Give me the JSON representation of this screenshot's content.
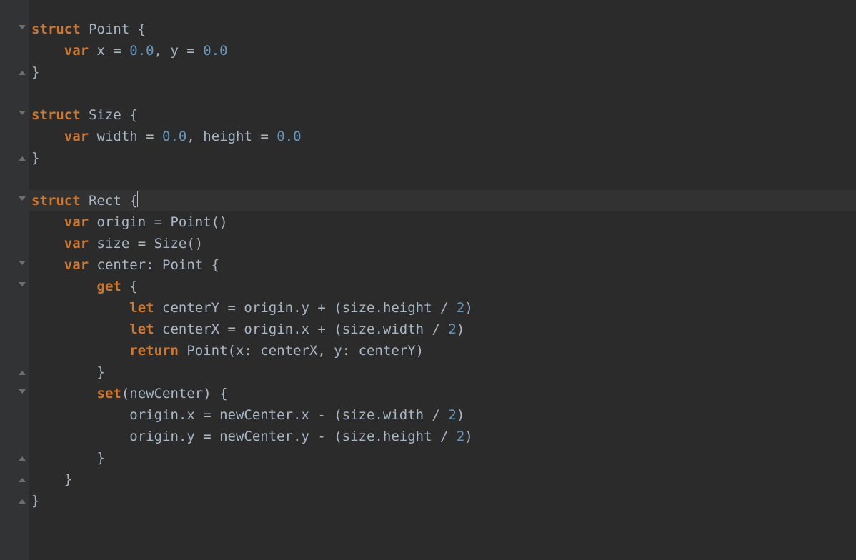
{
  "colors": {
    "background": "#2b2b2b",
    "gutter": "#313335",
    "foreground": "#a9b7c6",
    "keyword": "#cc7832",
    "number": "#6897bb",
    "line_highlight": "#323232"
  },
  "cursor": {
    "line_index": 8,
    "after_char": "Rec"
  },
  "lines": [
    {
      "fold": "open",
      "tokens": [
        {
          "t": "struct ",
          "c": "kw"
        },
        {
          "t": "Point {",
          "c": "type"
        }
      ]
    },
    {
      "fold": "",
      "tokens": [
        {
          "t": "    ",
          "c": ""
        },
        {
          "t": "var ",
          "c": "kw"
        },
        {
          "t": "x = ",
          "c": "type"
        },
        {
          "t": "0.0",
          "c": "num"
        },
        {
          "t": ", y = ",
          "c": "type"
        },
        {
          "t": "0.0",
          "c": "num"
        }
      ]
    },
    {
      "fold": "close",
      "tokens": [
        {
          "t": "}",
          "c": "type"
        }
      ]
    },
    {
      "fold": "",
      "tokens": []
    },
    {
      "fold": "open",
      "tokens": [
        {
          "t": "struct ",
          "c": "kw"
        },
        {
          "t": "Size {",
          "c": "type"
        }
      ]
    },
    {
      "fold": "",
      "tokens": [
        {
          "t": "    ",
          "c": ""
        },
        {
          "t": "var ",
          "c": "kw"
        },
        {
          "t": "width = ",
          "c": "type"
        },
        {
          "t": "0.0",
          "c": "num"
        },
        {
          "t": ", height = ",
          "c": "type"
        },
        {
          "t": "0.0",
          "c": "num"
        }
      ]
    },
    {
      "fold": "close",
      "tokens": [
        {
          "t": "}",
          "c": "type"
        }
      ]
    },
    {
      "fold": "",
      "tokens": []
    },
    {
      "fold": "open",
      "highlight": true,
      "cursor_after": 3,
      "tokens": [
        {
          "t": "struct ",
          "c": "kw"
        },
        {
          "t": "Rec",
          "c": "type"
        },
        {
          "t": "t {",
          "c": "type"
        }
      ]
    },
    {
      "fold": "",
      "tokens": [
        {
          "t": "    ",
          "c": ""
        },
        {
          "t": "var ",
          "c": "kw"
        },
        {
          "t": "origin = Point()",
          "c": "type"
        }
      ]
    },
    {
      "fold": "",
      "tokens": [
        {
          "t": "    ",
          "c": ""
        },
        {
          "t": "var ",
          "c": "kw"
        },
        {
          "t": "size = Size()",
          "c": "type"
        }
      ]
    },
    {
      "fold": "open",
      "tokens": [
        {
          "t": "    ",
          "c": ""
        },
        {
          "t": "var ",
          "c": "kw"
        },
        {
          "t": "center: Point {",
          "c": "type"
        }
      ]
    },
    {
      "fold": "open",
      "tokens": [
        {
          "t": "        ",
          "c": ""
        },
        {
          "t": "get ",
          "c": "kw"
        },
        {
          "t": "{",
          "c": "type"
        }
      ]
    },
    {
      "fold": "",
      "tokens": [
        {
          "t": "            ",
          "c": ""
        },
        {
          "t": "let ",
          "c": "kw"
        },
        {
          "t": "centerY = origin.y + (size.height / ",
          "c": "type"
        },
        {
          "t": "2",
          "c": "num"
        },
        {
          "t": ")",
          "c": "type"
        }
      ]
    },
    {
      "fold": "",
      "tokens": [
        {
          "t": "            ",
          "c": ""
        },
        {
          "t": "let ",
          "c": "kw"
        },
        {
          "t": "centerX = origin.x + (size.width / ",
          "c": "type"
        },
        {
          "t": "2",
          "c": "num"
        },
        {
          "t": ")",
          "c": "type"
        }
      ]
    },
    {
      "fold": "",
      "tokens": [
        {
          "t": "            ",
          "c": ""
        },
        {
          "t": "return ",
          "c": "kw"
        },
        {
          "t": "Point(x: centerX, y: centerY)",
          "c": "type"
        }
      ]
    },
    {
      "fold": "close",
      "tokens": [
        {
          "t": "        }",
          "c": "type"
        }
      ]
    },
    {
      "fold": "open",
      "tokens": [
        {
          "t": "        ",
          "c": ""
        },
        {
          "t": "set",
          "c": "kw"
        },
        {
          "t": "(newCenter) {",
          "c": "type"
        }
      ]
    },
    {
      "fold": "",
      "tokens": [
        {
          "t": "            origin.x = newCenter.x - (size.width / ",
          "c": "type"
        },
        {
          "t": "2",
          "c": "num"
        },
        {
          "t": ")",
          "c": "type"
        }
      ]
    },
    {
      "fold": "",
      "tokens": [
        {
          "t": "            origin.y = newCenter.y - (size.height / ",
          "c": "type"
        },
        {
          "t": "2",
          "c": "num"
        },
        {
          "t": ")",
          "c": "type"
        }
      ]
    },
    {
      "fold": "close",
      "tokens": [
        {
          "t": "        }",
          "c": "type"
        }
      ]
    },
    {
      "fold": "close",
      "tokens": [
        {
          "t": "    }",
          "c": "type"
        }
      ]
    },
    {
      "fold": "close",
      "tokens": [
        {
          "t": "}",
          "c": "type"
        }
      ]
    }
  ]
}
